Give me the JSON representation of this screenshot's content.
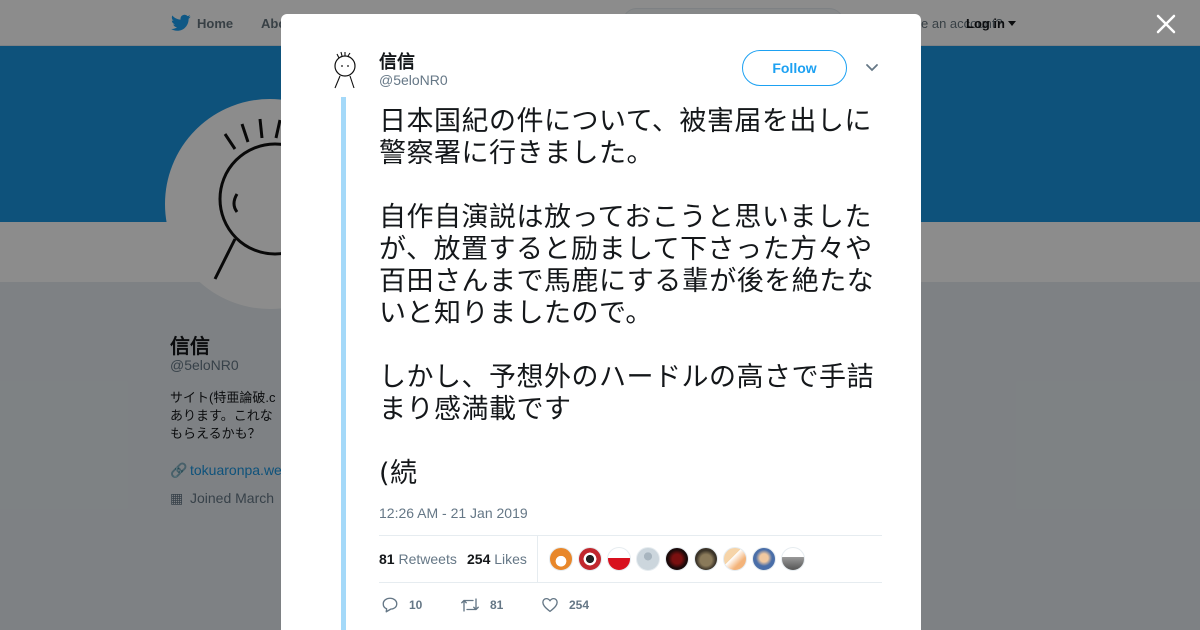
{
  "topbar": {
    "home_label": "Home",
    "about_label": "Abo",
    "have_account": "e an account?",
    "login_label": "Log in"
  },
  "profile": {
    "name": "信信",
    "handle": "@5eloNR0",
    "bio": "サイト(特亜論破.c\nあります。これな\nもらえるかも？",
    "link": "tokuaronpa.we",
    "joined": "Joined March"
  },
  "tweet": {
    "name": "信信",
    "handle": "@5eloNR0",
    "follow_label": "Follow",
    "text_paragraphs": [
      "日本国紀の件について、被害届を出しに警察署に行きました。",
      "自作自演説は放っておこうと思いましたが、放置すると励まして下さった方々や百田さんまで馬鹿にする輩が後を絶たないと知りましたので。",
      "しかし、予想外のハードルの高さで手詰まり感満載です",
      "(続"
    ],
    "timestamp": "12:26 AM - 21 Jan 2019",
    "retweets_count": "81",
    "retweets_label": "Retweets",
    "likes_count": "254",
    "likes_label": "Likes",
    "reply_count": "10",
    "retweet_action_count": "81",
    "like_action_count": "254"
  },
  "colors": {
    "brand": "#1da1f2",
    "banner": "#1b95e0",
    "thread_line": "#a4d9f9"
  },
  "icons": [
    "twitter-bird-icon",
    "close-icon",
    "chevron-down-icon",
    "reply-icon",
    "retweet-icon",
    "heart-icon",
    "link-icon",
    "calendar-icon"
  ]
}
